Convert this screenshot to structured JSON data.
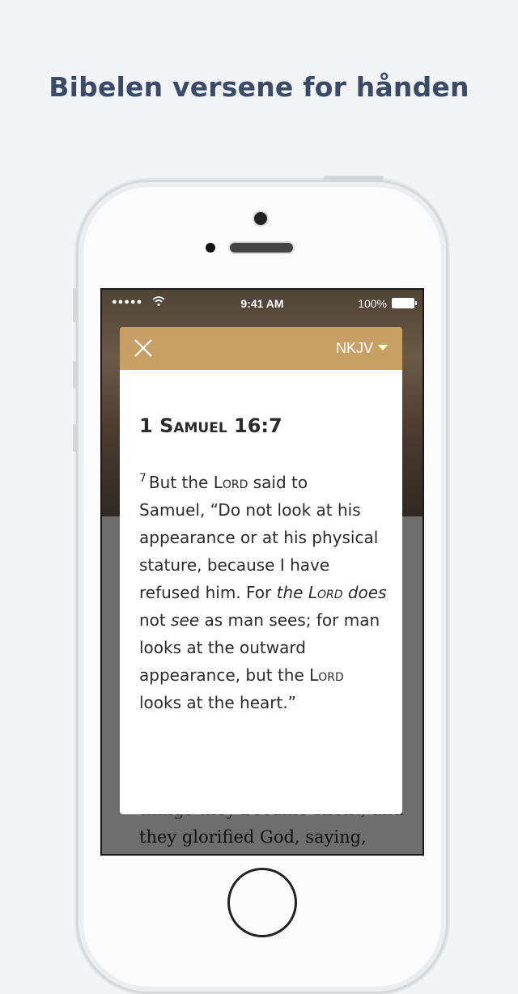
{
  "headline": "Bibelen versene for hånden",
  "status": {
    "signal": "●●●●●",
    "time": "9:41 AM",
    "battery": "100%"
  },
  "background_text": {
    "line1": "things they became silent, and",
    "line2": "they glorified God, saying,"
  },
  "modal": {
    "version_label": "NKJV",
    "reference": {
      "book_prefix": "1 ",
      "book_name": "Samuel",
      "chapter_verse": " 16:7"
    },
    "verse_number": "7",
    "verse_lines": [
      [
        "But the ",
        {
          "sc": "Lord"
        },
        " said to"
      ],
      [
        "Samuel, “Do not look at his"
      ],
      [
        "appearance or at his physical"
      ],
      [
        "stature, because I have"
      ],
      [
        "refused him. For ",
        {
          "i": "the "
        },
        {
          "isc": "Lord"
        },
        {
          "i": " does"
        }
      ],
      [
        "not ",
        {
          "i": "see"
        },
        " as man sees; for man"
      ],
      [
        "looks at the outward"
      ],
      [
        "appearance, but the ",
        {
          "sc": "Lord"
        }
      ],
      [
        "looks at the heart.”"
      ]
    ]
  },
  "colors": {
    "accent": "#c8a066",
    "headline": "#3a4a68",
    "page_bg": "#f3f4f6"
  }
}
